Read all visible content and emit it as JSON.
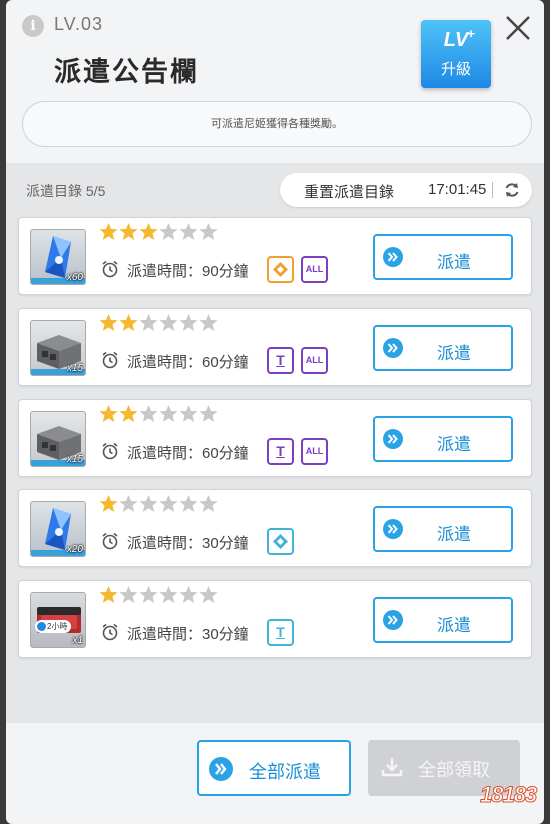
{
  "header": {
    "level": "LV.03",
    "title": "派遣公告欄",
    "upgrade": {
      "lv": "LV",
      "label": "升級"
    },
    "notice": "可派遣尼姬獲得各種獎勵。"
  },
  "list": {
    "label": "派遣目錄 5/5",
    "reset_label": "重置派遣目錄",
    "reset_time": "17:01:45"
  },
  "missions": [
    {
      "reward": "crystal",
      "qty": "x60",
      "stars": 3,
      "max_stars": 6,
      "duration": "派遣時間：90分鐘",
      "tags": [
        "gold-diamond",
        "ALL"
      ],
      "button": "派遣"
    },
    {
      "reward": "block",
      "qty": "x15",
      "stars": 2,
      "max_stars": 6,
      "duration": "派遣時間：60分鐘",
      "tags": [
        "T",
        "ALL"
      ],
      "button": "派遣"
    },
    {
      "reward": "block",
      "qty": "x15",
      "stars": 2,
      "max_stars": 6,
      "duration": "派遣時間：60分鐘",
      "tags": [
        "T",
        "ALL"
      ],
      "button": "派遣"
    },
    {
      "reward": "crystal",
      "qty": "x20",
      "stars": 1,
      "max_stars": 6,
      "duration": "派遣時間：30分鐘",
      "tags": [
        "teal-diamond"
      ],
      "button": "派遣"
    },
    {
      "reward": "box",
      "qty": "x1",
      "hours": "2小時",
      "stars": 1,
      "max_stars": 6,
      "duration": "派遣時間：30分鐘",
      "tags": [
        "T-teal"
      ],
      "button": "派遣"
    }
  ],
  "footer": {
    "dispatch_all": "全部派遣",
    "collect_all": "全部領取"
  },
  "watermark": "18183",
  "colors": {
    "accent": "#29a3e6",
    "star_filled": "#f5b82e",
    "star_empty": "#c8c8c8",
    "tag_gold": "#f0a02a",
    "tag_purple": "#7b3fc4",
    "tag_teal": "#3fb4d8"
  }
}
